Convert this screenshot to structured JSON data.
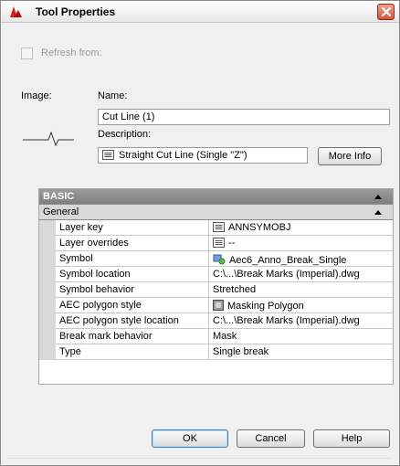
{
  "window": {
    "title": "Tool Properties"
  },
  "refresh": {
    "label": "Refresh from:",
    "checked": false
  },
  "image": {
    "label": "Image:"
  },
  "name": {
    "label": "Name:",
    "value": "Cut Line (1)"
  },
  "description": {
    "label": "Description:",
    "value": "Straight Cut Line (Single \"Z\")"
  },
  "more_info_label": "More Info",
  "grid": {
    "category": "BASIC",
    "subcategory": "General",
    "rows": [
      {
        "prop": "Layer key",
        "value": "ANNSYMOBJ",
        "icon": "layer-key-icon"
      },
      {
        "prop": "Layer overrides",
        "value": "--",
        "icon": "layer-overrides-icon"
      },
      {
        "prop": "Symbol",
        "value": "Aec6_Anno_Break_Single",
        "icon": "symbol-icon"
      },
      {
        "prop": "Symbol location",
        "value": "C:\\...\\Break Marks (Imperial).dwg",
        "icon": ""
      },
      {
        "prop": "Symbol behavior",
        "value": "Stretched",
        "icon": ""
      },
      {
        "prop": "AEC polygon style",
        "value": "Masking Polygon",
        "icon": "polygon-style-icon"
      },
      {
        "prop": "AEC polygon style location",
        "value": "C:\\...\\Break Marks (Imperial).dwg",
        "icon": ""
      },
      {
        "prop": "Break mark behavior",
        "value": "Mask",
        "icon": ""
      },
      {
        "prop": "Type",
        "value": "Single break",
        "icon": ""
      }
    ]
  },
  "buttons": {
    "ok": "OK",
    "cancel": "Cancel",
    "help": "Help"
  }
}
